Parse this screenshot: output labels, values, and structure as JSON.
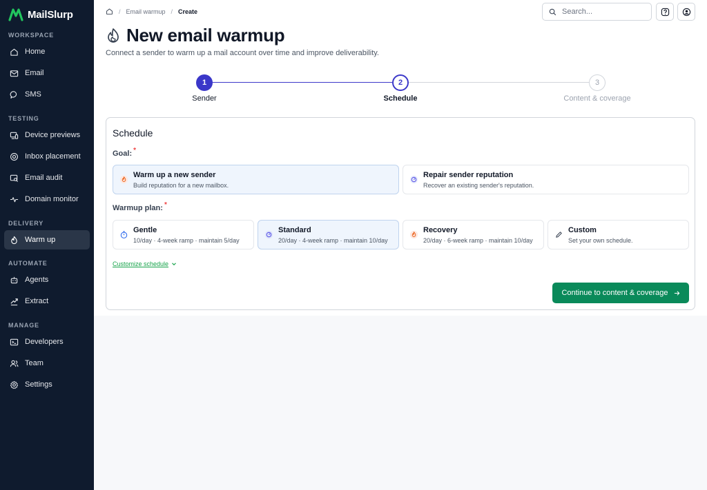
{
  "brand": {
    "name": "MailSlurp"
  },
  "sidebar": {
    "sections": [
      {
        "label": "WORKSPACE"
      },
      {
        "label": "TESTING"
      },
      {
        "label": "DELIVERY"
      },
      {
        "label": "AUTOMATE"
      },
      {
        "label": "MANAGE"
      }
    ],
    "items": [
      {
        "label": "Home",
        "icon": "home-icon"
      },
      {
        "label": "Email",
        "icon": "mail-icon"
      },
      {
        "label": "SMS",
        "icon": "chat-icon"
      },
      {
        "label": "Device previews",
        "icon": "devices-icon"
      },
      {
        "label": "Inbox placement",
        "icon": "target-icon"
      },
      {
        "label": "Email audit",
        "icon": "audit-icon"
      },
      {
        "label": "Domain monitor",
        "icon": "pulse-icon"
      },
      {
        "label": "Warm up",
        "icon": "flame-icon",
        "active": true
      },
      {
        "label": "Agents",
        "icon": "robot-icon"
      },
      {
        "label": "Extract",
        "icon": "extract-icon"
      },
      {
        "label": "Developers",
        "icon": "terminal-icon"
      },
      {
        "label": "Team",
        "icon": "users-icon"
      },
      {
        "label": "Settings",
        "icon": "gear-icon"
      }
    ]
  },
  "breadcrumb": {
    "first": "Email warmup",
    "current": "Create"
  },
  "search": {
    "placeholder": "Search..."
  },
  "page": {
    "title": "New email warmup",
    "subtitle": "Connect a sender to warm up a mail account over time and improve deliverability."
  },
  "stepper": {
    "steps": [
      {
        "number": "1",
        "label": "Sender",
        "state": "complete"
      },
      {
        "number": "2",
        "label": "Schedule",
        "state": "current"
      },
      {
        "number": "3",
        "label": "Content & coverage",
        "state": "upcoming"
      }
    ]
  },
  "schedule": {
    "title": "Schedule",
    "goal_label": "Goal:",
    "required_mark": "*",
    "goals": [
      {
        "title": "Warm up a new sender",
        "desc": "Build reputation for a new mailbox.",
        "icon": "flame-icon",
        "selected": true
      },
      {
        "title": "Repair sender reputation",
        "desc": "Recover an existing sender's reputation.",
        "icon": "gauge-icon",
        "selected": false
      }
    ],
    "plan_label": "Warmup plan:",
    "plans": [
      {
        "title": "Gentle",
        "desc": "10/day · 4-week ramp · maintain 5/day",
        "icon": "timer-icon",
        "selected": false
      },
      {
        "title": "Standard",
        "desc": "20/day · 4-week ramp · maintain 10/day",
        "icon": "gauge-icon",
        "selected": true
      },
      {
        "title": "Recovery",
        "desc": "20/day · 6-week ramp · maintain 10/day",
        "icon": "flame-icon",
        "selected": false
      },
      {
        "title": "Custom",
        "desc": "Set your own schedule.",
        "icon": "pencil-icon",
        "selected": false
      }
    ],
    "customize_link": "Customize schedule",
    "continue_label": "Continue to content & coverage"
  },
  "colors": {
    "sidebar_bg": "#0f1b2e",
    "accent": "#3b37c9",
    "primary_button": "#0a8a5a",
    "selected_option_bg": "#eff5fd"
  }
}
